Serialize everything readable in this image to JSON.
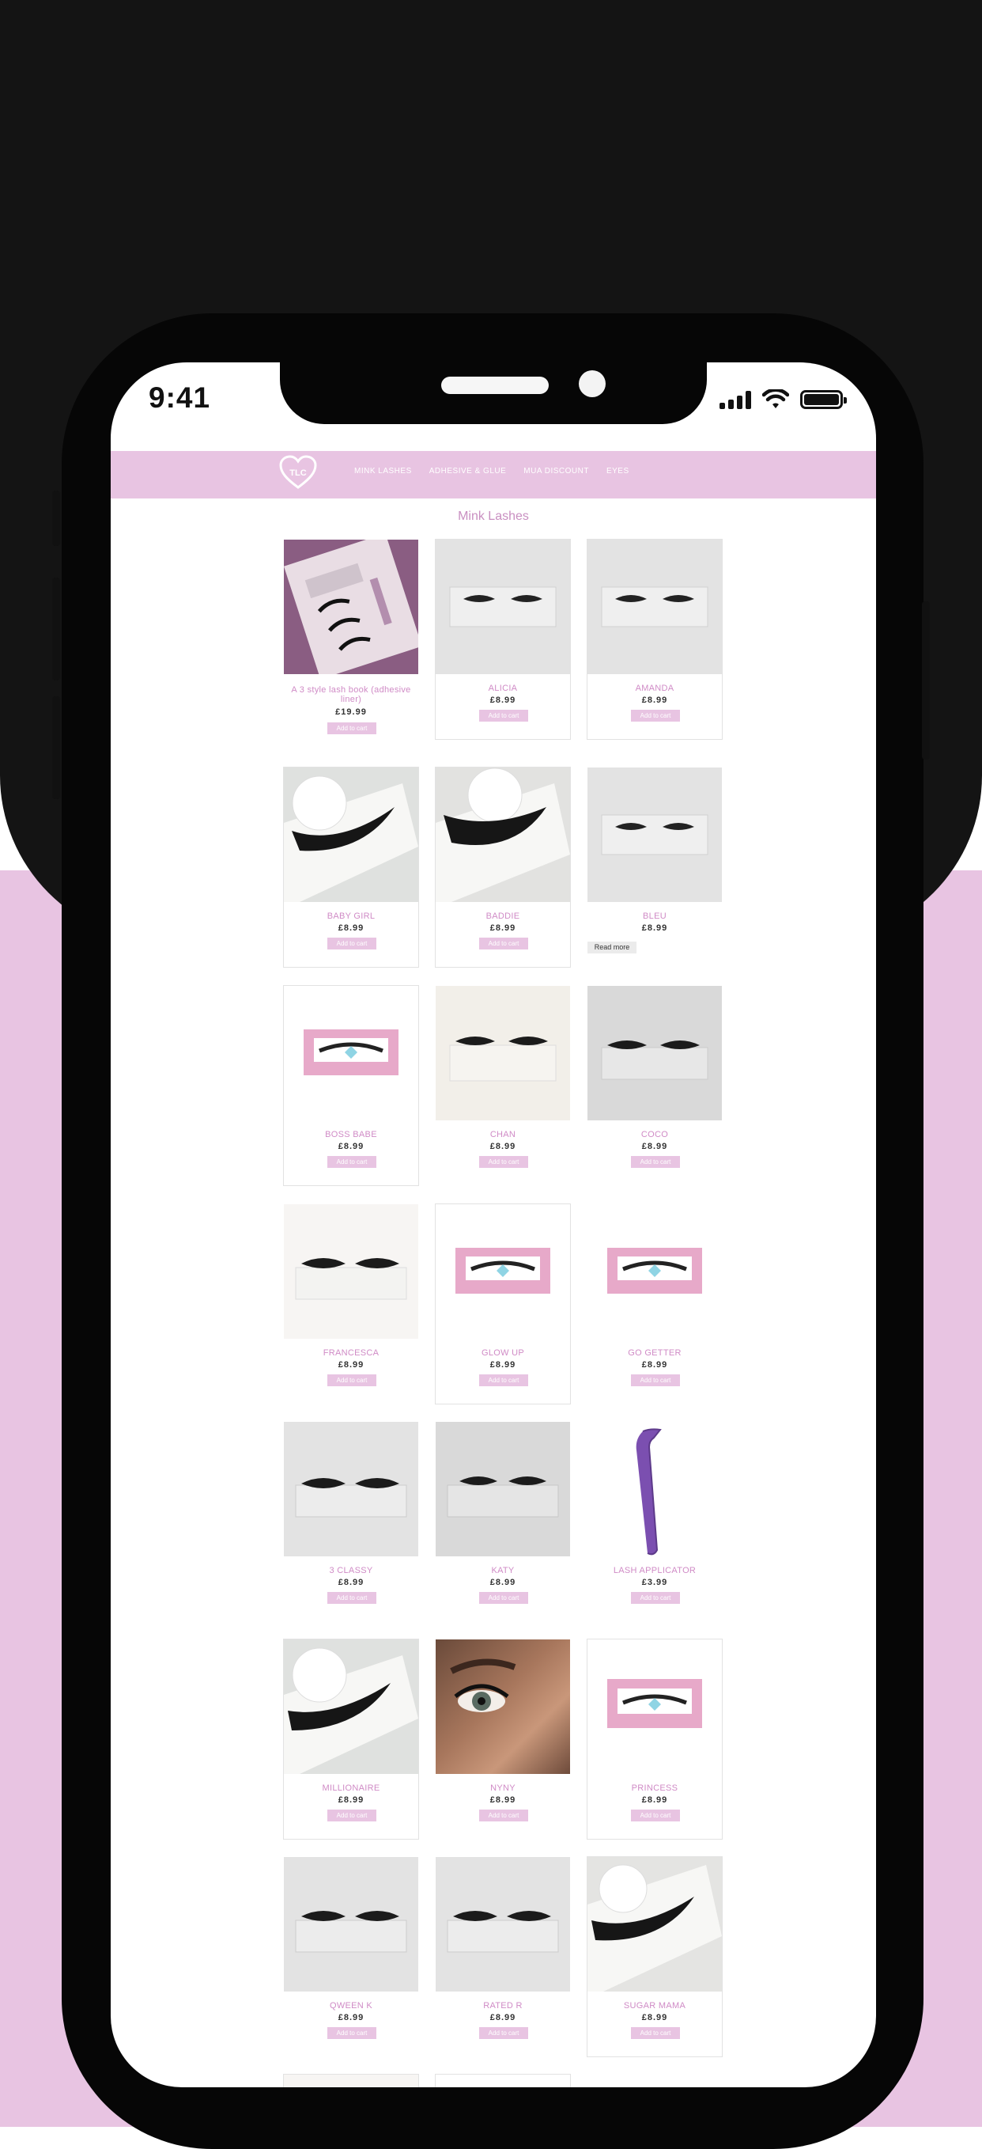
{
  "status_bar": {
    "time": "9:41"
  },
  "nav": {
    "logo_text": "TLC",
    "links": [
      "MINK LASHES",
      "ADHESIVE & GLUE",
      "MUA DISCOUNT",
      "EYES"
    ]
  },
  "page": {
    "title": "Mink Lashes"
  },
  "cta": {
    "add_to_cart": "Add to cart",
    "read_more": "Read more"
  },
  "products": [
    {
      "name": "A 3 style lash book (adhesive liner)",
      "price": "£19.99",
      "image": "lash-book-photo"
    },
    {
      "name": "ALICIA",
      "price": "£8.99",
      "image": "lash-tray-photo"
    },
    {
      "name": "AMANDA",
      "price": "£8.99",
      "image": "lash-tray-photo"
    },
    {
      "name": "BABY GIRL",
      "price": "£8.99",
      "image": "lash-closeup-photo"
    },
    {
      "name": "BADDIE",
      "price": "£8.99",
      "image": "lash-closeup-photo"
    },
    {
      "name": "BLEU",
      "price": "£8.99",
      "image": "lash-tray-photo",
      "button": "read_more"
    },
    {
      "name": "BOSS BABE",
      "price": "£8.99",
      "image": "pink-box-photo"
    },
    {
      "name": "CHAN",
      "price": "£8.99",
      "image": "lash-tray-photo"
    },
    {
      "name": "COCO",
      "price": "£8.99",
      "image": "lash-tray-photo"
    },
    {
      "name": "FRANCESCA",
      "price": "£8.99",
      "image": "lash-tray-photo"
    },
    {
      "name": "GLOW UP",
      "price": "£8.99",
      "image": "pink-box-photo"
    },
    {
      "name": "GO GETTER",
      "price": "£8.99",
      "image": "pink-box-photo"
    },
    {
      "name": "3 CLASSY",
      "price": "£8.99",
      "image": "lash-tray-photo"
    },
    {
      "name": "KATY",
      "price": "£8.99",
      "image": "lash-tray-photo"
    },
    {
      "name": "LASH APPLICATOR",
      "price": "£3.99",
      "image": "applicator-photo"
    },
    {
      "name": "MILLIONAIRE",
      "price": "£8.99",
      "image": "lash-closeup-photo"
    },
    {
      "name": "NYNY",
      "price": "£8.99",
      "image": "model-eye-photo"
    },
    {
      "name": "PRINCESS",
      "price": "£8.99",
      "image": "pink-box-photo"
    },
    {
      "name": "QWEEN K",
      "price": "£8.99",
      "image": "lash-tray-photo"
    },
    {
      "name": "RATED R",
      "price": "£8.99",
      "image": "lash-tray-photo"
    },
    {
      "name": "SUGAR MAMA",
      "price": "£8.99",
      "image": "lash-closeup-photo"
    }
  ],
  "colors": {
    "brand_pink": "#e8c4e2",
    "title_pink": "#c98fc1",
    "phone_frame": "#060606",
    "backdrop_dark": "#141414"
  }
}
